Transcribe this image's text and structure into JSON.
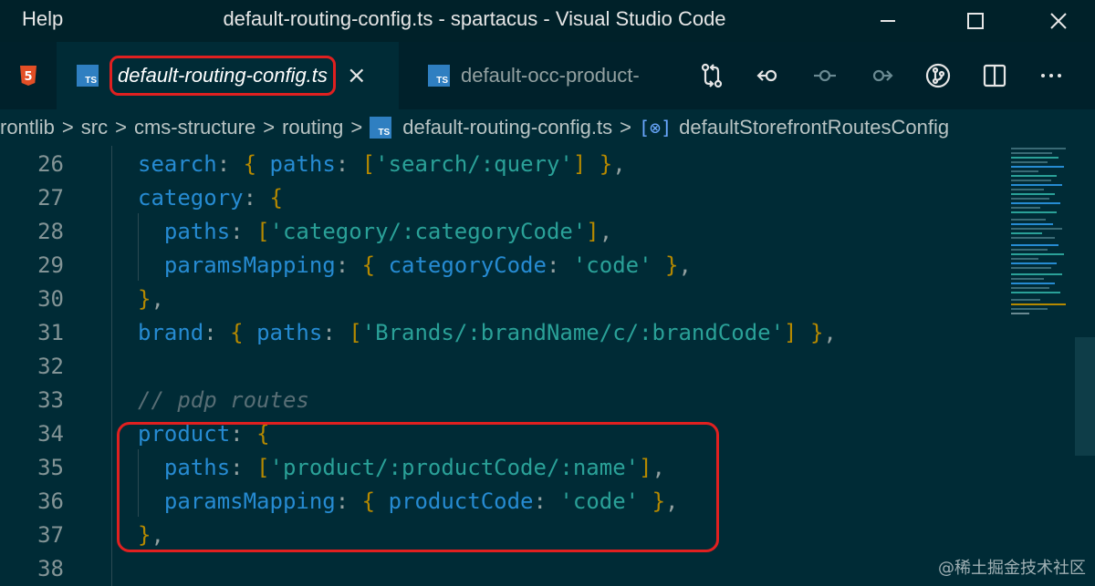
{
  "titlebar": {
    "menu_help": "Help",
    "title": "default-routing-config.ts - spartacus - Visual Studio Code"
  },
  "tabs": {
    "html_icon": "html5-icon",
    "active": {
      "icon": "TS",
      "label": "default-routing-config.ts",
      "close": "×"
    },
    "inactive": {
      "icon": "TS",
      "label": "default-occ-product-"
    }
  },
  "breadcrumb": {
    "items": [
      "rontlib",
      "src",
      "cms-structure",
      "routing",
      "default-routing-config.ts",
      "defaultStorefrontRoutesConfig"
    ],
    "separator": ">"
  },
  "editor": {
    "line_numbers": [
      "26",
      "27",
      "28",
      "29",
      "30",
      "31",
      "32",
      "33",
      "34",
      "35",
      "36",
      "37",
      "38"
    ],
    "comment": "// pdp routes"
  },
  "watermark": "@稀土掘金技术社区",
  "colors": {
    "background": "#002b36",
    "keyword": "#268bd2",
    "string": "#2aa198",
    "bracket": "#b58900",
    "highlight": "#e02020"
  }
}
